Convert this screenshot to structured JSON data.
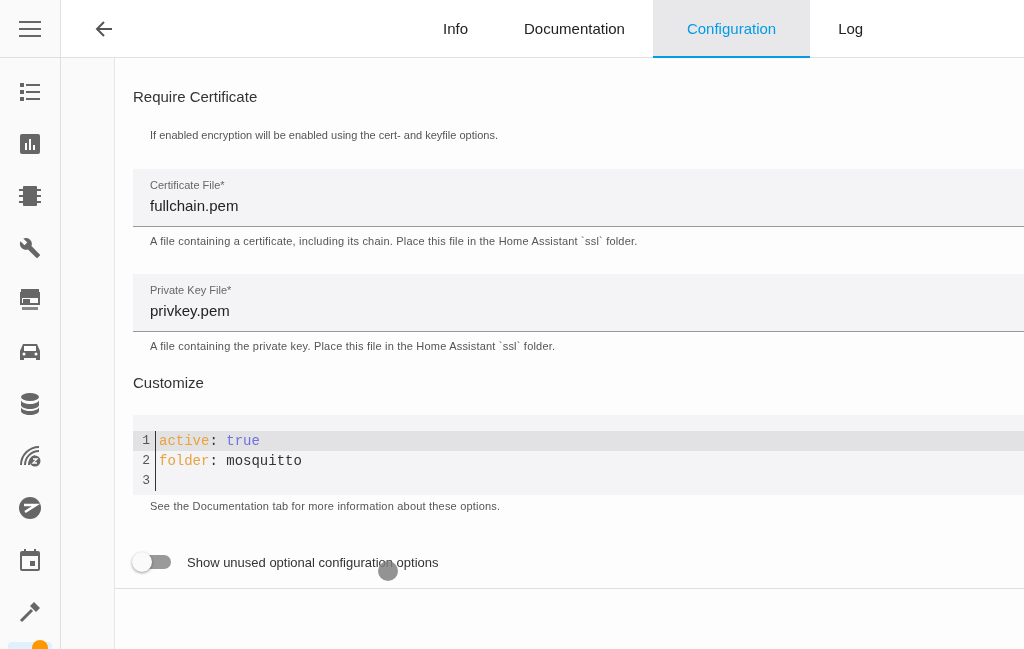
{
  "sidebar": {
    "items": [
      {
        "selected": false,
        "badge": false
      },
      {
        "selected": false,
        "badge": false
      },
      {
        "selected": false,
        "badge": false
      },
      {
        "selected": false,
        "badge": false
      },
      {
        "selected": false,
        "badge": false
      },
      {
        "selected": false,
        "badge": false
      },
      {
        "selected": false,
        "badge": false
      },
      {
        "selected": false,
        "badge": false
      },
      {
        "selected": false,
        "badge": false
      },
      {
        "selected": false,
        "badge": false
      },
      {
        "selected": false,
        "badge": false
      },
      {
        "selected": true,
        "badge": true
      }
    ]
  },
  "tabs": [
    {
      "label": "Info",
      "selected": false
    },
    {
      "label": "Documentation",
      "selected": false
    },
    {
      "label": "Configuration",
      "selected": true
    },
    {
      "label": "Log",
      "selected": false
    }
  ],
  "sections": [
    {
      "kind": "heading",
      "text": "Require Certificate"
    },
    {
      "kind": "description",
      "text": "If enabled encryption will be enabled using the cert- and keyfile options."
    },
    {
      "kind": "field",
      "label": "Certificate File*",
      "value": "fullchain.pem",
      "helper": "A file containing a certificate, including its chain. Place this file in the Home Assistant `ssl` folder."
    },
    {
      "kind": "field",
      "label": "Private Key File*",
      "value": "privkey.pem",
      "helper": "A file containing the private key. Place this file in the Home Assistant `ssl` folder."
    },
    {
      "kind": "heading",
      "text": "Customize"
    }
  ],
  "editor": {
    "lines": [
      {
        "number": "1",
        "active": true,
        "tokens": [
          {
            "kind": "key",
            "text": "active"
          },
          {
            "kind": "punct",
            "text": ": "
          },
          {
            "kind": "bool",
            "text": "true"
          }
        ]
      },
      {
        "number": "2",
        "active": false,
        "tokens": [
          {
            "kind": "key",
            "text": "folder"
          },
          {
            "kind": "punct",
            "text": ": "
          },
          {
            "kind": "string",
            "text": "mosquitto"
          }
        ]
      },
      {
        "number": "3",
        "active": false
      }
    ],
    "helper": "See the Documentation tab for more information about these options."
  },
  "toggle": {
    "label": "Show unused optional configuration options",
    "on": false
  }
}
